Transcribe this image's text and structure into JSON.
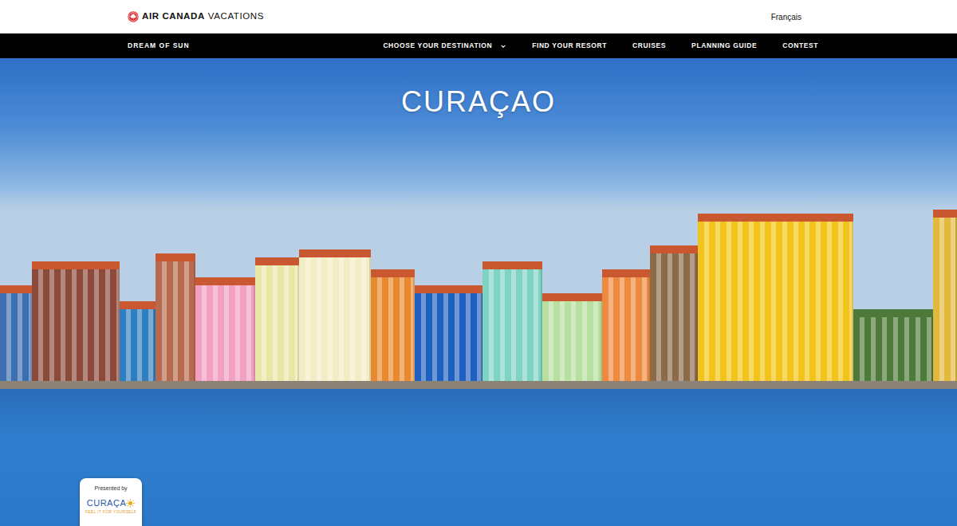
{
  "brand": {
    "name": "AIR CANADA",
    "suffix": "VACATIONS"
  },
  "language_link": "Français",
  "nav": {
    "tagline": "DREAM OF SUN",
    "items": [
      {
        "label": "CHOOSE YOUR DESTINATION",
        "kind": "dropdown"
      },
      {
        "label": "FIND YOUR RESORT",
        "kind": "link"
      },
      {
        "label": "CRUISES",
        "kind": "link"
      },
      {
        "label": "PLANNING GUIDE",
        "kind": "link"
      },
      {
        "label": "CONTEST",
        "kind": "link"
      }
    ]
  },
  "hero": {
    "title": "CURAÇAO"
  },
  "sponsor": {
    "label": "Presented by",
    "logo": "CURAÇA",
    "slogan": "FEEL IT FOR YOURSELF"
  }
}
